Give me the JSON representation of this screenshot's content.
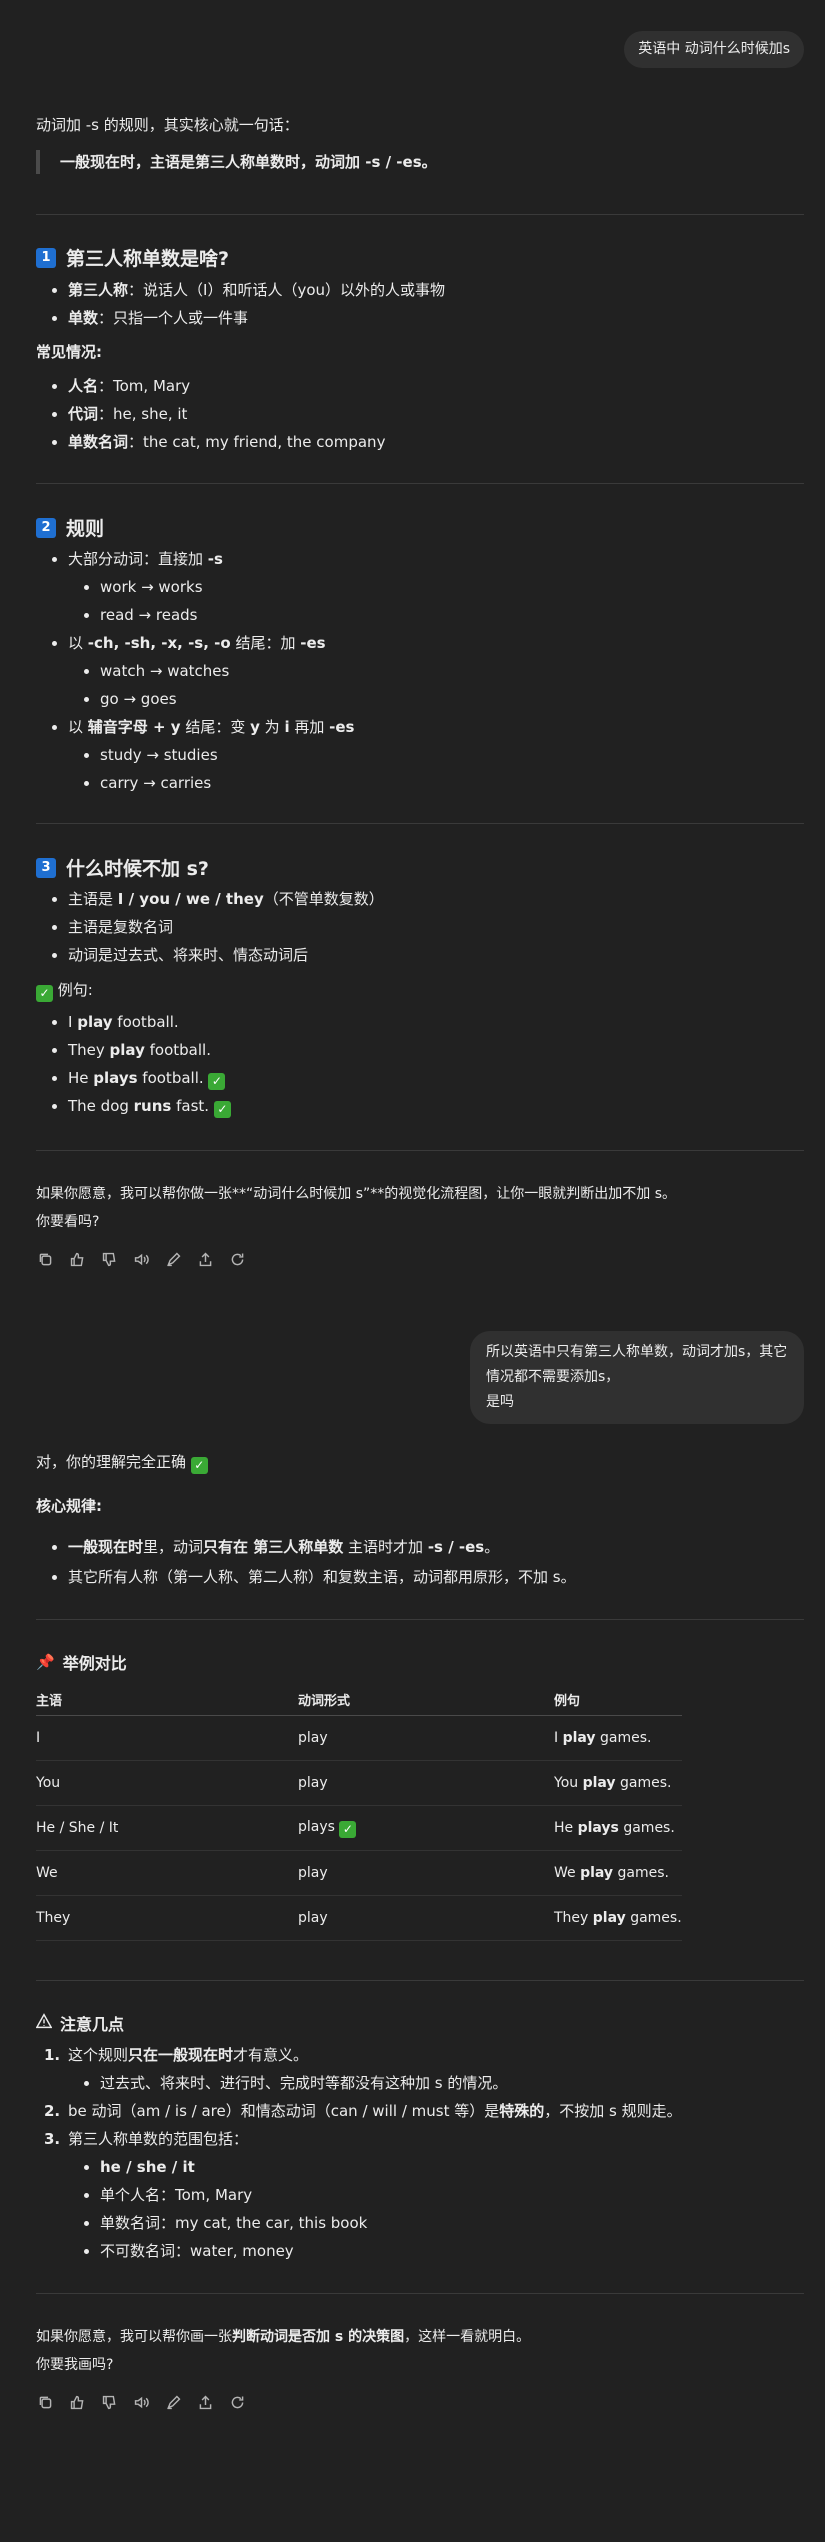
{
  "msg1": {
    "user_text": "英语中 动词什么时候加s",
    "intro": "动词加 -s 的规则，其实核心就一句话：",
    "quote": "一般现在时，主语是第三人称单数时，动词加 -s / -es。",
    "sec1": {
      "num": "1",
      "title": "第三人称单数是啥?",
      "b1_key": "第三人称",
      "b1_rest": "：说话人（I）和听话人（you）以外的人或事物",
      "b2_key": "单数",
      "b2_rest": "：只指一个人或一件事",
      "common": "常见情况:",
      "c1_key": "人名",
      "c1_rest": "：Tom, Mary",
      "c2_key": "代词",
      "c2_rest": "：he, she, it",
      "c3_key": "单数名词",
      "c3_rest": "：the cat, my friend, the company"
    },
    "sec2": {
      "num": "2",
      "title": "规则",
      "r1": "大部分动词：直接加 ",
      "r1_b": "-s",
      "r1_ex1": "work → works",
      "r1_ex2": "read → reads",
      "r2_pre": "以 ",
      "r2_b": "-ch, -sh, -x, -s, -o",
      "r2_mid": " 结尾：加 ",
      "r2_b2": "-es",
      "r2_ex1": "watch → watches",
      "r2_ex2": "go → goes",
      "r3_pre": "以 ",
      "r3_b": "辅音字母 + y",
      "r3_mid": " 结尾：变 ",
      "r3_b2": "y",
      "r3_mid2": " 为 ",
      "r3_b3": "i",
      "r3_mid3": " 再加 ",
      "r3_b4": "-es",
      "r3_ex1": "study → studies",
      "r3_ex2": "carry → carries"
    },
    "sec3": {
      "num": "3",
      "title": "什么时候不加 s?",
      "n1_pre": "主语是 ",
      "n1_b": "I / you / we / they",
      "n1_rest": "（不管单数复数）",
      "n2": "主语是复数名词",
      "n3": "动词是过去式、将来时、情态动词后",
      "ex_label": "例句:",
      "e1_a": "I ",
      "e1_b": "play",
      "e1_c": " football.",
      "e2_a": "They ",
      "e2_b": "play",
      "e2_c": " football.",
      "e3_a": "He ",
      "e3_b": "plays",
      "e3_c": " football.",
      "e4_a": "The dog ",
      "e4_b": "runs",
      "e4_c": " fast."
    },
    "outro1": "如果你愿意，我可以帮你做一张**“动词什么时候加 s”**的视觉化流程图，让你一眼就判断出加不加 s。",
    "outro2": "你要看吗?"
  },
  "msg2": {
    "user_text_1": "所以英语中只有第三人称单数，动词才加s，其它情况都不需要添加s，",
    "user_text_2": "是吗",
    "reply": "对，你的理解完全正确",
    "core_label": "核心规律:",
    "k1_b1": "一般现在时",
    "k1_t1": "里，动词",
    "k1_b2": "只有在 第三人称单数",
    "k1_t2": " 主语时才加 ",
    "k1_b3": "-s / -es",
    "k1_t3": "。",
    "k2": "其它所有人称（第一人称、第二人称）和复数主语，动词都用原形，不加 s。",
    "compare_title": "举例对比",
    "table": {
      "headers": [
        "主语",
        "动词形式",
        "例句"
      ],
      "rows": [
        {
          "subject": "I",
          "verb": "play",
          "ex_a": "I ",
          "ex_b": "play",
          "ex_c": " games."
        },
        {
          "subject": "You",
          "verb": "play",
          "ex_a": "You ",
          "ex_b": "play",
          "ex_c": " games."
        },
        {
          "subject": "He / She / It",
          "verb": "plays",
          "ex_a": "He ",
          "ex_b": "plays",
          "ex_c": " games."
        },
        {
          "subject": "We",
          "verb": "play",
          "ex_a": "We ",
          "ex_b": "play",
          "ex_c": " games."
        },
        {
          "subject": "They",
          "verb": "play",
          "ex_a": "They ",
          "ex_b": "play",
          "ex_c": " games."
        }
      ]
    },
    "notes_title": "注意几点",
    "o1_t1": "这个规则",
    "o1_b": "只在一般现在时",
    "o1_t2": "才有意义。",
    "o1_sub": "过去式、将来时、进行时、完成时等都没有这种加 s 的情况。",
    "o2_t1": "be 动词（am / is / are）和情态动词（can / will / must 等）是",
    "o2_b": "特殊的",
    "o2_t2": "，不按加 s 规则走。",
    "o3": "第三人称单数的范围包括：",
    "o3_s1": "he / she / it",
    "o3_s2": "单个人名：Tom, Mary",
    "o3_s3": "单数名词：my cat, the car, this book",
    "o3_s4": "不可数名词：water, money",
    "outro1_a": "如果你愿意，我可以帮你画一张",
    "outro1_b": "判断动词是否加 s 的决策图",
    "outro1_c": "，这样一看就明白。",
    "outro2": "你要我画吗?"
  },
  "icons": [
    "copy-icon",
    "thumbs-up-icon",
    "thumbs-down-icon",
    "speaker-icon",
    "edit-icon",
    "share-icon",
    "regenerate-icon"
  ]
}
